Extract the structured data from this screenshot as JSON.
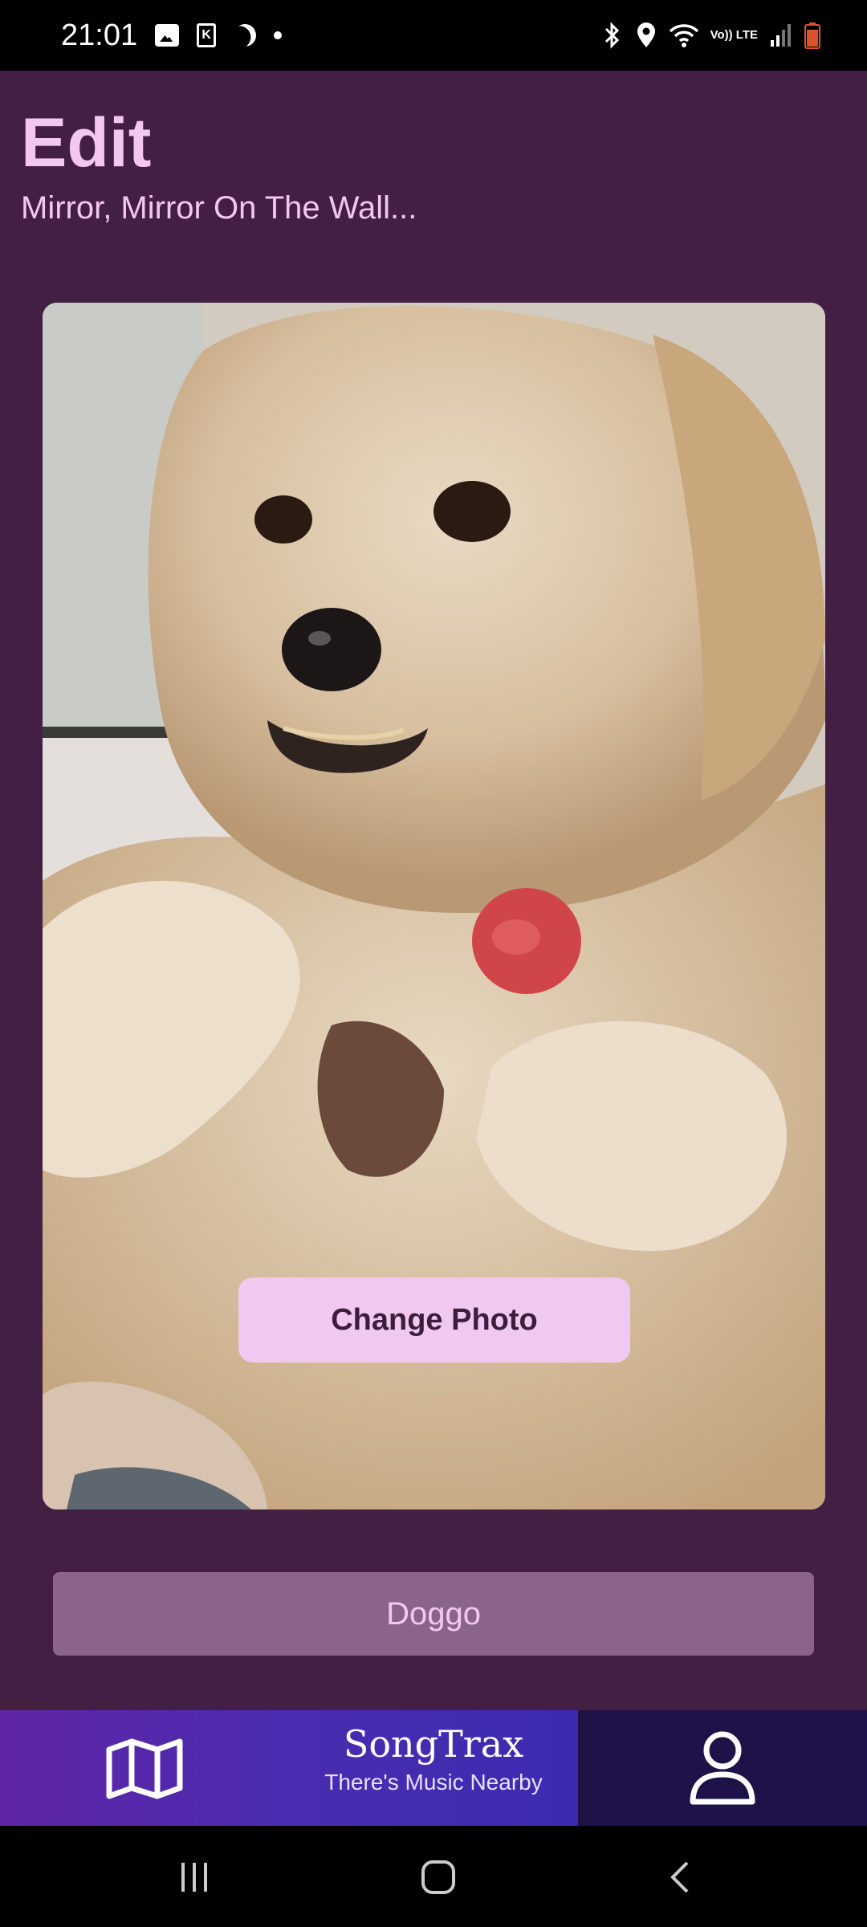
{
  "status_bar": {
    "time": "21:01",
    "left_icons": [
      "image-icon",
      "k-app-icon",
      "moon-icon",
      "dot-icon"
    ],
    "right_icons": [
      "bluetooth-icon",
      "location-icon",
      "wifi-icon",
      "volte-icon",
      "signal-icon",
      "battery-icon"
    ],
    "volte_text": "Vo)) LTE"
  },
  "header": {
    "title": "Edit",
    "subtitle": "Mirror, Mirror On The Wall..."
  },
  "photo": {
    "change_photo_label": "Change Photo"
  },
  "name_field": {
    "value": "Doggo"
  },
  "bottom_nav": {
    "brand_name": "SongTrax",
    "brand_tagline": "There's Music Nearby",
    "left_icon": "map-icon",
    "right_icon": "user-profile-icon"
  },
  "system_nav": {
    "icons": [
      "recent-apps-icon",
      "home-icon",
      "back-icon"
    ]
  },
  "colors": {
    "background": "#432043",
    "accent_text": "#f3c8f0",
    "button_bg": "#f0c8f0",
    "field_bg": "#8b6589",
    "nav_gradient_start": "#5f25a6",
    "nav_gradient_end": "#3b2bb0",
    "nav_right_bg": "#1e1248"
  }
}
